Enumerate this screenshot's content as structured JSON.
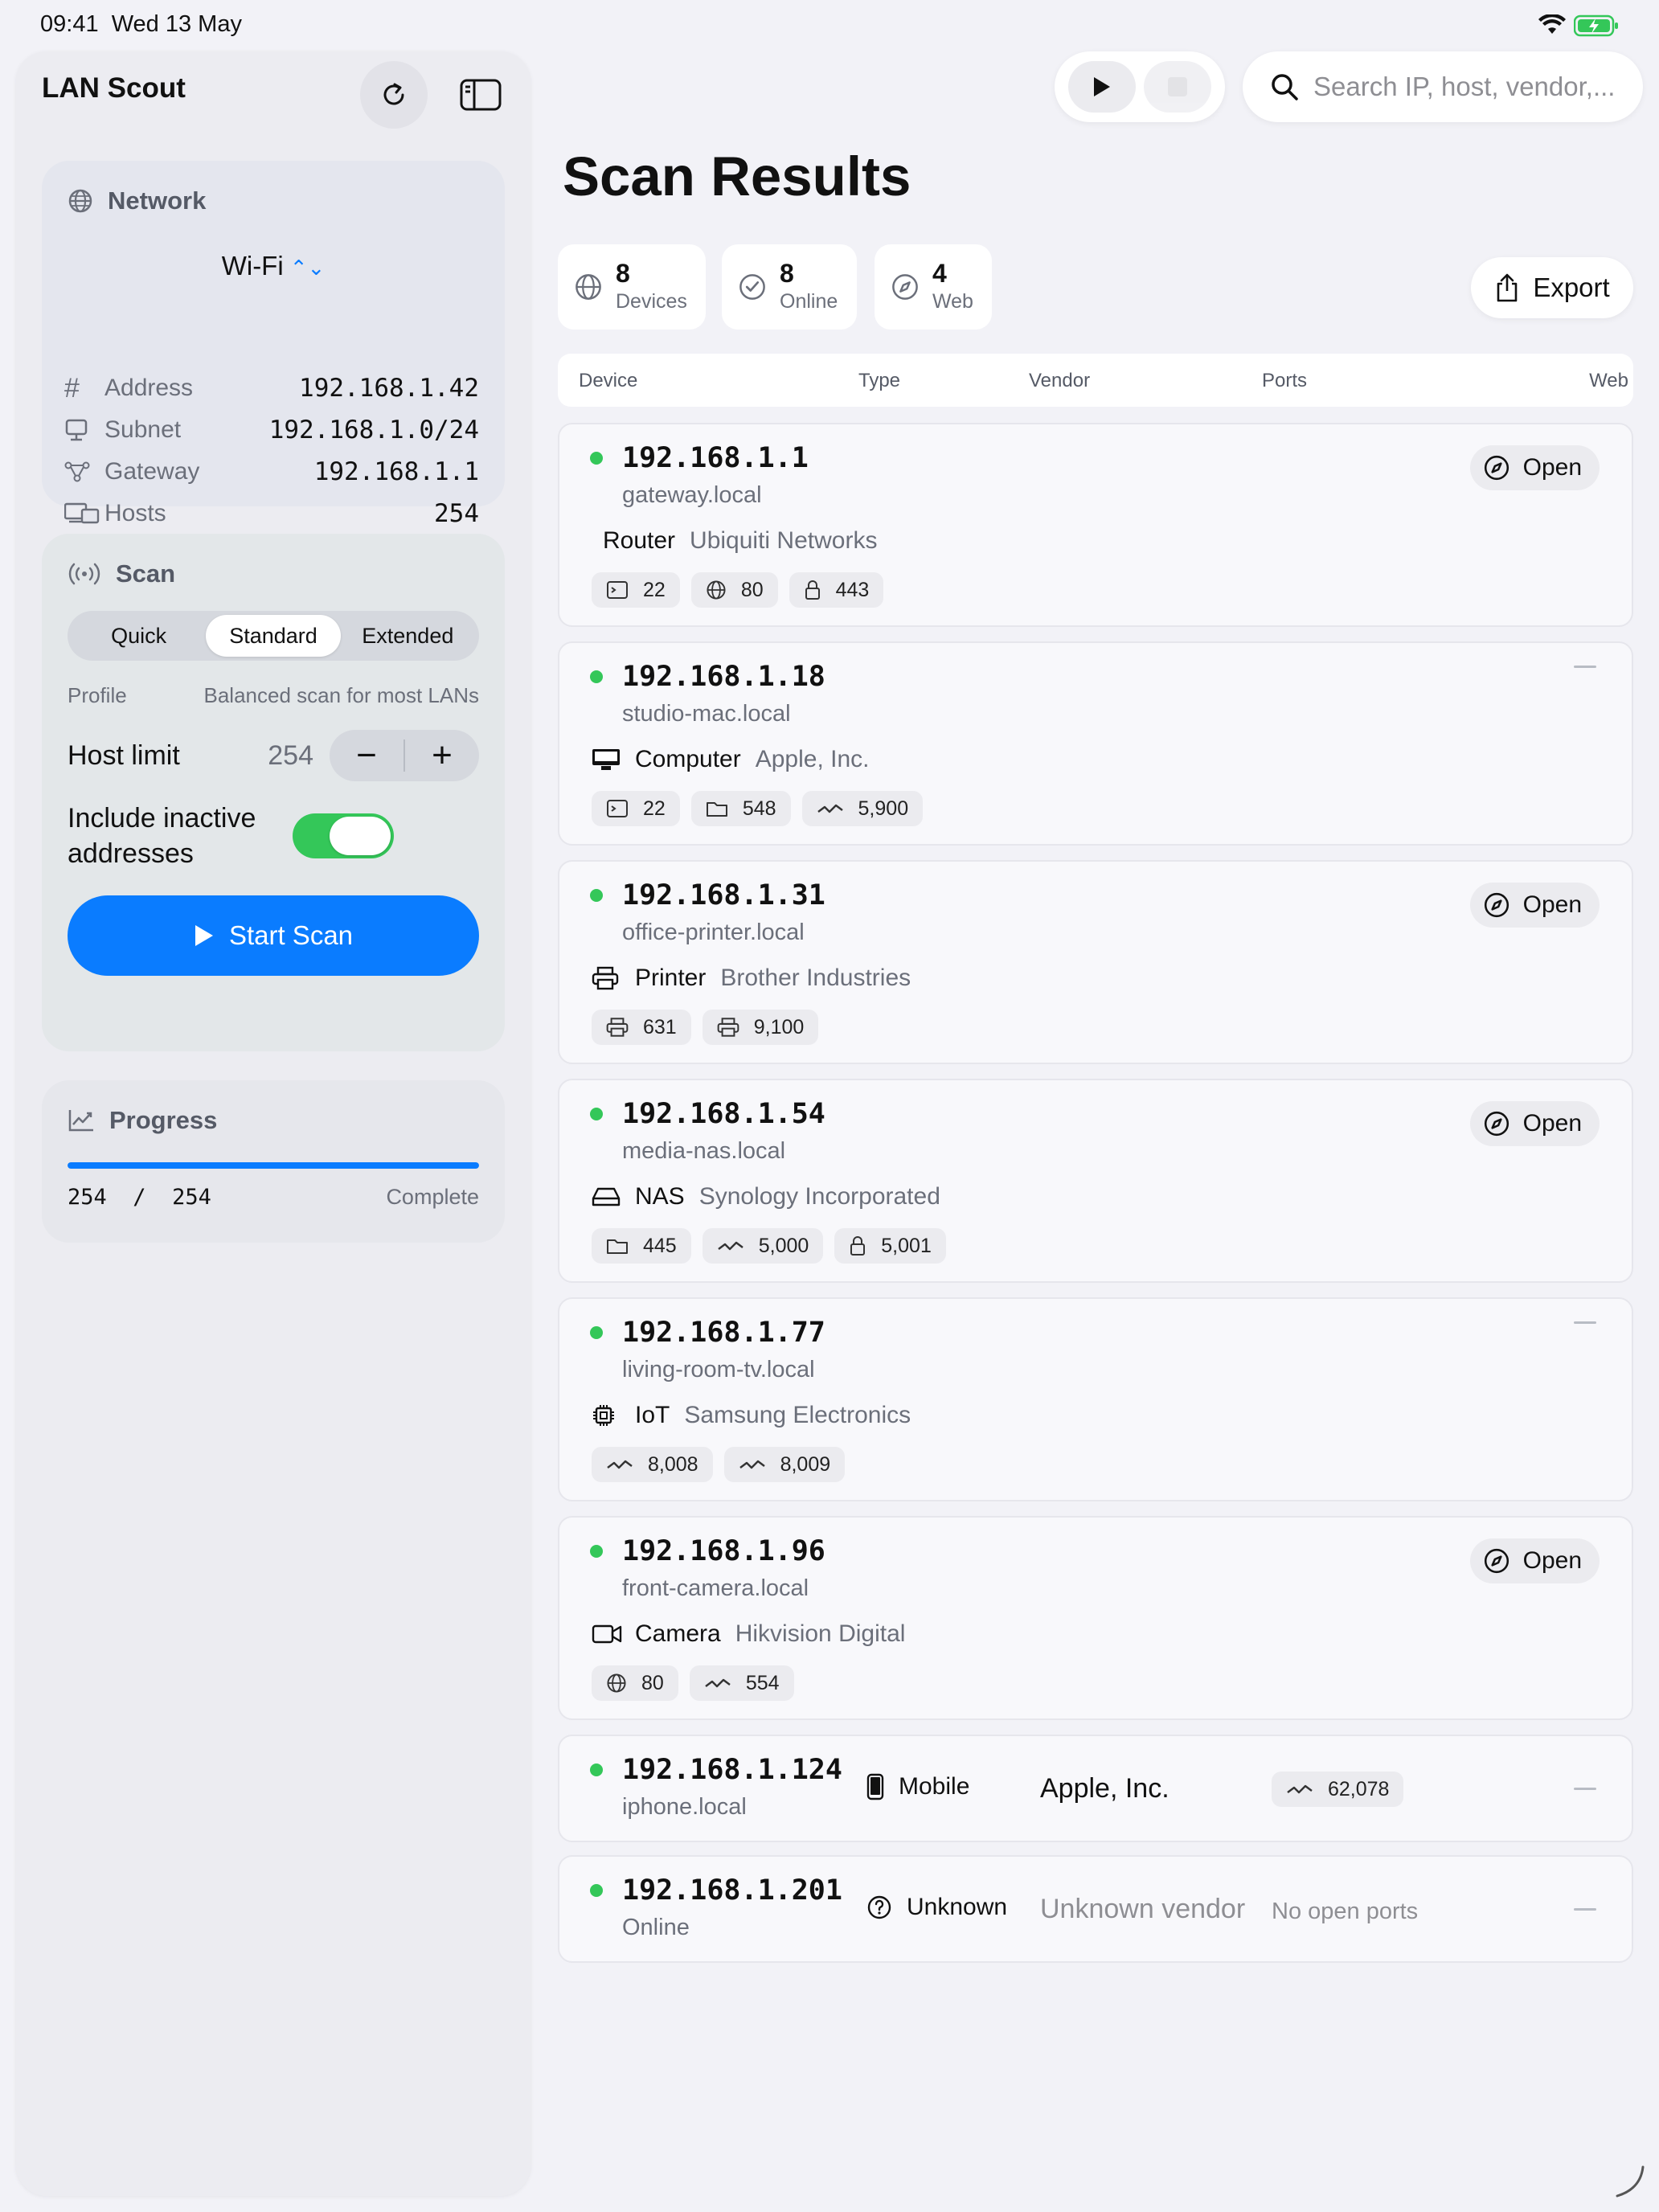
{
  "status_bar": {
    "time": "09:41",
    "date": "Wed 13 May",
    "wifi_icon": "wifi-icon",
    "battery_icon": "battery-charging-icon"
  },
  "sidebar": {
    "title": "LAN Scout",
    "refresh_icon": "refresh-icon",
    "toggle_icon": "sidebar-toggle-icon",
    "network": {
      "heading": "Network",
      "interface": "Wi-Fi",
      "rows": [
        {
          "label": "Address",
          "value": "192.168.1.42",
          "icon": "hash-icon"
        },
        {
          "label": "Subnet",
          "value": "192.168.1.0/24",
          "icon": "monitor-icon"
        },
        {
          "label": "Gateway",
          "value": "192.168.1.1",
          "icon": "network-nodes-icon"
        },
        {
          "label": "Hosts",
          "value": "254",
          "icon": "devices-icon"
        }
      ]
    },
    "scan": {
      "heading": "Scan",
      "modes": [
        "Quick",
        "Standard",
        "Extended"
      ],
      "selected_mode": "Standard",
      "profile_label": "Profile",
      "profile_value": "Balanced scan for most LANs",
      "host_limit_label": "Host limit",
      "host_limit_value": "254",
      "minus": "−",
      "plus": "+",
      "include_inactive_label": "Include inactive addresses",
      "include_inactive_on": true,
      "start_label": "Start Scan"
    },
    "progress": {
      "heading": "Progress",
      "done": "254",
      "separator": "/",
      "total": "254",
      "fraction": 1.0,
      "status": "Complete"
    }
  },
  "toolbar": {
    "search_placeholder": "Search IP, host, vendor,..."
  },
  "main": {
    "title": "Scan Results",
    "stats": [
      {
        "value": "8",
        "label": "Devices",
        "icon": "globe-icon"
      },
      {
        "value": "8",
        "label": "Online",
        "icon": "checkmark-circle-icon"
      },
      {
        "value": "4",
        "label": "Web",
        "icon": "compass-icon"
      }
    ],
    "export_label": "Export",
    "columns": [
      "Device",
      "Type",
      "Vendor",
      "Ports",
      "Web"
    ],
    "open_label": "Open",
    "devices": [
      {
        "ip": "192.168.1.1",
        "host": "gateway.local",
        "type": "Router",
        "type_icon": "",
        "vendor": "Ubiquiti Networks",
        "ports": [
          {
            "icon": "terminal-icon",
            "value": "22"
          },
          {
            "icon": "globe-icon",
            "value": "80"
          },
          {
            "icon": "lock-icon",
            "value": "443"
          }
        ],
        "web": true
      },
      {
        "ip": "192.168.1.18",
        "host": "studio-mac.local",
        "type": "Computer",
        "type_icon": "desktop-icon",
        "vendor": "Apple, Inc.",
        "ports": [
          {
            "icon": "terminal-icon",
            "value": "22"
          },
          {
            "icon": "folder-icon",
            "value": "548"
          },
          {
            "icon": "waveform-icon",
            "value": "5,900"
          }
        ],
        "web": false
      },
      {
        "ip": "192.168.1.31",
        "host": "office-printer.local",
        "type": "Printer",
        "type_icon": "printer-icon",
        "vendor": "Brother Industries",
        "ports": [
          {
            "icon": "printer-icon",
            "value": "631"
          },
          {
            "icon": "printer-icon",
            "value": "9,100"
          }
        ],
        "web": true
      },
      {
        "ip": "192.168.1.54",
        "host": "media-nas.local",
        "type": "NAS",
        "type_icon": "drive-icon",
        "vendor": "Synology Incorporated",
        "ports": [
          {
            "icon": "folder-icon",
            "value": "445"
          },
          {
            "icon": "waveform-icon",
            "value": "5,000"
          },
          {
            "icon": "lock-icon",
            "value": "5,001"
          }
        ],
        "web": true
      },
      {
        "ip": "192.168.1.77",
        "host": "living-room-tv.local",
        "type": "IoT",
        "type_icon": "chip-icon",
        "vendor": "Samsung Electronics",
        "ports": [
          {
            "icon": "waveform-icon",
            "value": "8,008"
          },
          {
            "icon": "waveform-icon",
            "value": "8,009"
          }
        ],
        "web": false
      },
      {
        "ip": "192.168.1.96",
        "host": "front-camera.local",
        "type": "Camera",
        "type_icon": "video-camera-icon",
        "vendor": "Hikvision Digital",
        "ports": [
          {
            "icon": "globe-icon",
            "value": "80"
          },
          {
            "icon": "waveform-icon",
            "value": "554"
          }
        ],
        "web": true
      },
      {
        "ip": "192.168.1.124",
        "host": "iphone.local",
        "type": "Mobile",
        "type_icon": "phone-icon",
        "vendor": "Apple, Inc.",
        "ports": [
          {
            "icon": "waveform-icon",
            "value": "62,078"
          }
        ],
        "web": false
      },
      {
        "ip": "192.168.1.201",
        "host": "Online",
        "type": "Unknown",
        "type_icon": "question-circle-icon",
        "vendor": "Unknown vendor",
        "ports_text": "No open ports",
        "web": false
      }
    ]
  },
  "colors": {
    "accent": "#0a7cff",
    "online": "#34c759",
    "toggle_on": "#34c759"
  }
}
